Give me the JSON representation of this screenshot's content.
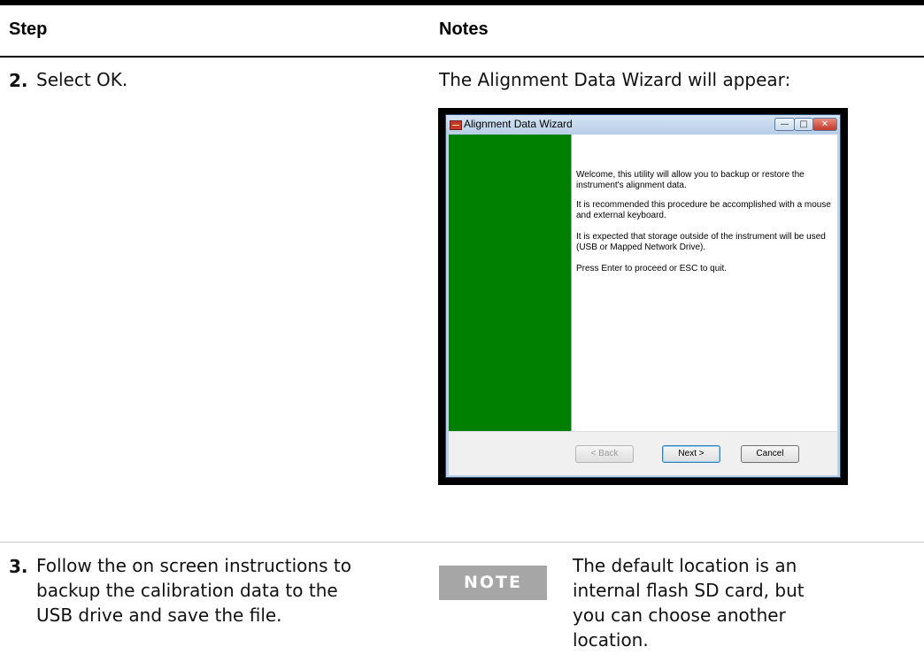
{
  "table": {
    "header": {
      "step": "Step",
      "notes": "Notes"
    },
    "rows": [
      {
        "number": "2.",
        "step_text": "Select OK.",
        "notes_text": "The Alignment Data Wizard will appear:"
      },
      {
        "number": "3.",
        "step_lines": [
          "Follow the on screen instructions to",
          "backup the calibration data to the",
          "USB drive and save the file."
        ],
        "note_badge": "NOTE",
        "note_lines": [
          "The default location is an",
          "internal flash SD card, but",
          "you can choose another",
          "location."
        ]
      }
    ]
  },
  "wizard": {
    "title": "Alignment Data Wizard",
    "caption_buttons": {
      "minimize": "—",
      "maximize": "□",
      "close": "✕"
    },
    "panel_color": "#008000",
    "paragraphs": [
      [
        "Welcome, this utility will allow you to backup or restore the",
        "instrument's alignment data."
      ],
      [
        "It is recommended this procedure be accomplished with a mouse",
        "and external keyboard."
      ],
      [
        "It is expected that storage outside of the instrument will be used",
        "(USB or Mapped Network Drive)."
      ],
      [
        "Press Enter to proceed or ESC to quit."
      ]
    ],
    "buttons": {
      "back": "< Back",
      "next": "Next >",
      "cancel": "Cancel"
    }
  }
}
